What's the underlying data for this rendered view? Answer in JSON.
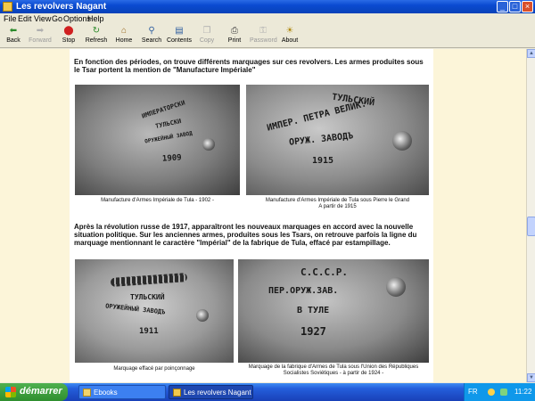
{
  "window": {
    "title": "Les revolvers Nagant",
    "controls": {
      "minimize": "_",
      "maximize": "□",
      "close": "×"
    }
  },
  "menu": {
    "items": [
      "File",
      "Edit",
      "View",
      "Go",
      "Options",
      "Help"
    ]
  },
  "toolbar": {
    "buttons": [
      {
        "label": "Back",
        "icon": "back-arrow-icon",
        "enabled": true
      },
      {
        "label": "Forward",
        "icon": "forward-arrow-icon",
        "enabled": false
      },
      {
        "label": "Stop",
        "icon": "stop-icon",
        "enabled": true
      },
      {
        "label": "Refresh",
        "icon": "refresh-icon",
        "enabled": true
      },
      {
        "label": "Home",
        "icon": "home-icon",
        "enabled": true
      },
      {
        "label": "Search",
        "icon": "search-icon",
        "enabled": true
      },
      {
        "label": "Contents",
        "icon": "contents-icon",
        "enabled": true
      },
      {
        "label": "Copy",
        "icon": "copy-icon",
        "enabled": false
      },
      {
        "label": "Print",
        "icon": "print-icon",
        "enabled": true
      },
      {
        "label": "Password",
        "icon": "password-icon",
        "enabled": false
      },
      {
        "label": "About",
        "icon": "about-icon",
        "enabled": true
      }
    ]
  },
  "content": {
    "para1": "En fonction des périodes, on trouve différents marquages sur ces revolvers. Les armes produites sous le Tsar portent la mention de \"Manufacture Impériale\"",
    "para2": "Après la révolution russe de 1917, apparaîtront les nouveaux marquages en accord avec la nouvelle situation politique. Sur les anciennes armes, produites sous les Tsars, on retrouve parfois la ligne du marquage mentionnant le caractère \"Impérial\" de la fabrique de Tula, effacé par estampillage.",
    "photos": {
      "p1": {
        "lines": [
          "ИМПЕРАТОРСКИ",
          "ТУЛЬСКИ",
          "ОРУЖЕЙНЫЙ ЗАВОД",
          "1909"
        ],
        "caption": "Manufacture d'Armes Impériale de Tula - 1902 -"
      },
      "p2": {
        "lines": [
          "ТУЛЬСКИЙ",
          "ИМПЕР. ПЕТРА ВЕЛИК.",
          "ОРУЖ. ЗАВОДЪ",
          "1915"
        ],
        "caption_l1": "Manufacture d'Armes Impériale de Tula sous Pierre le Grand",
        "caption_l2": "A partir de  1915"
      },
      "p3": {
        "lines": [
          "ТУЛЬСКИЙ",
          "ОРУЖЕЙНЫЙ ЗАВОДЪ",
          "1911"
        ],
        "caption": "Marquage effacé par poinçonnage"
      },
      "p4": {
        "lines": [
          "С.С.С.Р.",
          "ПЕР.ОРУЖ.ЗАВ.",
          "В ТУЛЕ",
          "1927"
        ],
        "caption_l1": "Marquage de la fabrique d'Armes de Tula sous l'Union des Républiques",
        "caption_l2": "Socialistes Soviétiques - à partir de 1924 -"
      }
    }
  },
  "taskbar": {
    "start_label": "démarrer",
    "tasks": [
      {
        "label": "Ebooks",
        "icon": "folder-icon",
        "active": false
      },
      {
        "label": "Les revolvers Nagant",
        "icon": "help-viewer-icon",
        "active": true
      }
    ],
    "tray": {
      "language": "FR",
      "time": "11:22"
    }
  },
  "colors": {
    "page_background": "#fcf5d9",
    "titlebar": "#0a4ad0",
    "taskbar": "#245edb",
    "start_button": "#2f8f2f"
  }
}
